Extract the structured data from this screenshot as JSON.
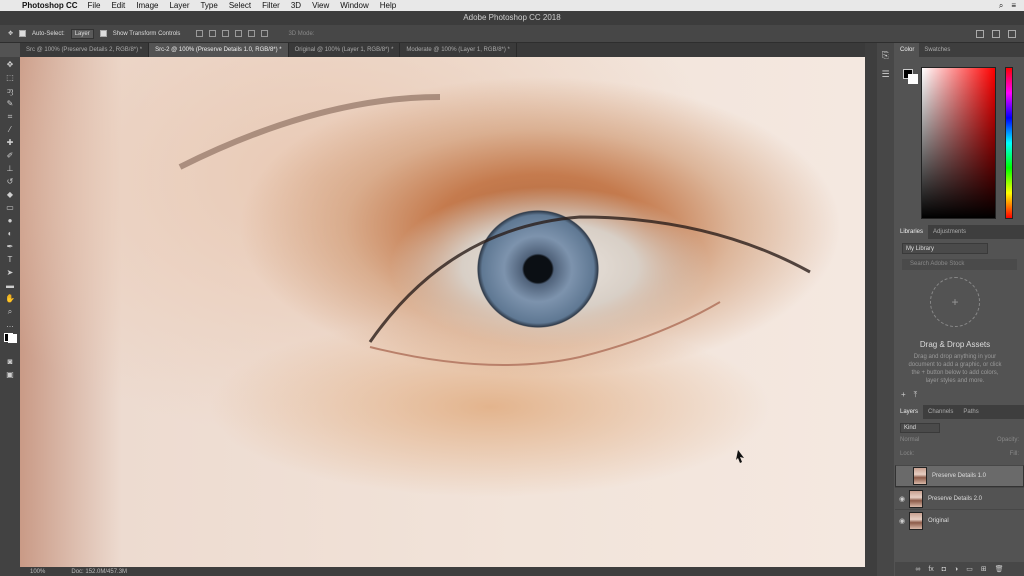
{
  "menubar": {
    "apple_icon": "apple-icon",
    "app_name": "Photoshop CC",
    "items": [
      "File",
      "Edit",
      "Image",
      "Layer",
      "Type",
      "Select",
      "Filter",
      "3D",
      "View",
      "Window",
      "Help"
    ]
  },
  "window_title": "Adobe Photoshop CC 2018",
  "options": {
    "auto_select_label": "Auto-Select:",
    "auto_select_value": "Layer",
    "transform_label": "Show Transform Controls",
    "mode_3d": "3D Mode:"
  },
  "tabs": [
    {
      "label": "Src @ 100% (Preserve Details 2, RGB/8*) *"
    },
    {
      "label": "Src-2 @ 100% (Preserve Details 1.0, RGB/8*) *"
    },
    {
      "label": "Original @ 100% (Layer 1, RGB/8*) *"
    },
    {
      "label": "Moderate @ 100% (Layer 1, RGB/8*) *"
    }
  ],
  "status": {
    "zoom": "100%",
    "doc": "Doc: 152.0M/457.3M"
  },
  "color_panel": {
    "tabs": [
      "Color",
      "Swatches"
    ]
  },
  "libraries_panel": {
    "tabs": [
      "Libraries",
      "Adjustments"
    ],
    "library": "My Library",
    "search_placeholder": "Search Adobe Stock",
    "drop_title": "Drag & Drop Assets",
    "drop_text": "Drag and drop anything in your document to add a graphic, or click the + button below to add colors, layer styles and more."
  },
  "layers_panel": {
    "tabs": [
      "Layers",
      "Channels",
      "Paths"
    ],
    "kind": "Kind",
    "blend": "Normal",
    "opacity_label": "Opacity:",
    "lock_label": "Lock:",
    "fill_label": "Fill:",
    "layers": [
      {
        "name": "Preserve Details 1.0",
        "visible": false,
        "selected": true
      },
      {
        "name": "Preserve Details 2.0",
        "visible": true,
        "selected": false
      },
      {
        "name": "Original",
        "visible": true,
        "selected": false
      }
    ]
  }
}
